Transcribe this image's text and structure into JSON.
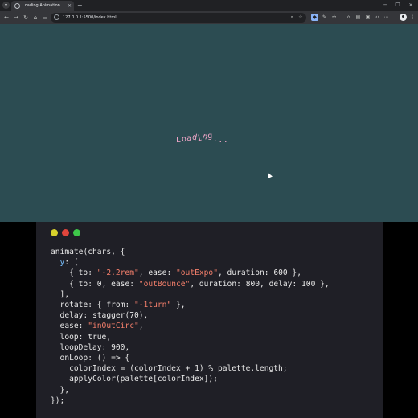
{
  "browser": {
    "tab_title": "Loading Animation",
    "url": "127.0.0.1:5500/index.html"
  },
  "page": {
    "loading_chars": [
      "L",
      "o",
      "a",
      "d",
      "i",
      "n",
      "g",
      ".",
      ".",
      "."
    ],
    "text_color": "#f2a7c9",
    "background_color": "#2c4c52"
  },
  "code_window": {
    "dot_colors": [
      "#d7d12c",
      "#e0453c",
      "#3ec74a"
    ],
    "lines": [
      [
        [
          "animate",
          "#e8e8e8"
        ],
        [
          "(",
          "#e8e8e8"
        ],
        [
          "chars",
          "#e8e8e8"
        ],
        [
          ", {",
          "#e8e8e8"
        ]
      ],
      [
        [
          "  y",
          "#79c0ff"
        ],
        [
          ": [",
          "#e8e8e8"
        ]
      ],
      [
        [
          "    { ",
          "#e8e8e8"
        ],
        [
          "to",
          "#e8e8e8"
        ],
        [
          ": ",
          "#e8e8e8"
        ],
        [
          "\"-2.2rem\"",
          "#f47f6b"
        ],
        [
          ", ",
          "#e8e8e8"
        ],
        [
          "ease",
          "#e8e8e8"
        ],
        [
          ": ",
          "#e8e8e8"
        ],
        [
          "\"outExpo\"",
          "#f47f6b"
        ],
        [
          ", ",
          "#e8e8e8"
        ],
        [
          "duration",
          "#e8e8e8"
        ],
        [
          ": ",
          "#e8e8e8"
        ],
        [
          "600",
          "#e8e8e8"
        ],
        [
          " },",
          "#e8e8e8"
        ]
      ],
      [
        [
          "    { ",
          "#e8e8e8"
        ],
        [
          "to",
          "#e8e8e8"
        ],
        [
          ": ",
          "#e8e8e8"
        ],
        [
          "0",
          "#e8e8e8"
        ],
        [
          ", ",
          "#e8e8e8"
        ],
        [
          "ease",
          "#e8e8e8"
        ],
        [
          ": ",
          "#e8e8e8"
        ],
        [
          "\"outBounce\"",
          "#f47f6b"
        ],
        [
          ", ",
          "#e8e8e8"
        ],
        [
          "duration",
          "#e8e8e8"
        ],
        [
          ": ",
          "#e8e8e8"
        ],
        [
          "800",
          "#e8e8e8"
        ],
        [
          ", ",
          "#e8e8e8"
        ],
        [
          "delay",
          "#e8e8e8"
        ],
        [
          ": ",
          "#e8e8e8"
        ],
        [
          "100",
          "#e8e8e8"
        ],
        [
          " },",
          "#e8e8e8"
        ]
      ],
      [
        [
          "  ],",
          "#e8e8e8"
        ]
      ],
      [
        [
          "  rotate",
          "#e8e8e8"
        ],
        [
          ": { ",
          "#e8e8e8"
        ],
        [
          "from",
          "#e8e8e8"
        ],
        [
          ": ",
          "#e8e8e8"
        ],
        [
          "\"-1turn\"",
          "#f47f6b"
        ],
        [
          " },",
          "#e8e8e8"
        ]
      ],
      [
        [
          "  delay",
          "#e8e8e8"
        ],
        [
          ": ",
          "#e8e8e8"
        ],
        [
          "stagger",
          "#e8e8e8"
        ],
        [
          "(",
          "#e8e8e8"
        ],
        [
          "70",
          "#e8e8e8"
        ],
        [
          "),",
          "#e8e8e8"
        ]
      ],
      [
        [
          "  ease",
          "#e8e8e8"
        ],
        [
          ": ",
          "#e8e8e8"
        ],
        [
          "\"inOutCirc\"",
          "#f47f6b"
        ],
        [
          ",",
          "#e8e8e8"
        ]
      ],
      [
        [
          "  loop",
          "#e8e8e8"
        ],
        [
          ": ",
          "#e8e8e8"
        ],
        [
          "true",
          "#e8e8e8"
        ],
        [
          ",",
          "#e8e8e8"
        ]
      ],
      [
        [
          "  loopDelay",
          "#e8e8e8"
        ],
        [
          ": ",
          "#e8e8e8"
        ],
        [
          "900",
          "#e8e8e8"
        ],
        [
          ",",
          "#e8e8e8"
        ]
      ],
      [
        [
          "  onLoop",
          "#e8e8e8"
        ],
        [
          ": () => {",
          "#e8e8e8"
        ]
      ],
      [
        [
          "    colorIndex = (colorIndex + ",
          "#e8e8e8"
        ],
        [
          "1",
          "#e8e8e8"
        ],
        [
          ") % palette.length;",
          "#e8e8e8"
        ]
      ],
      [
        [
          "    applyColor",
          "#e8e8e8"
        ],
        [
          "(palette[colorIndex]);",
          "#e8e8e8"
        ]
      ],
      [
        [
          "  },",
          "#e8e8e8"
        ]
      ],
      [
        [
          "});",
          "#e8e8e8"
        ]
      ]
    ]
  }
}
